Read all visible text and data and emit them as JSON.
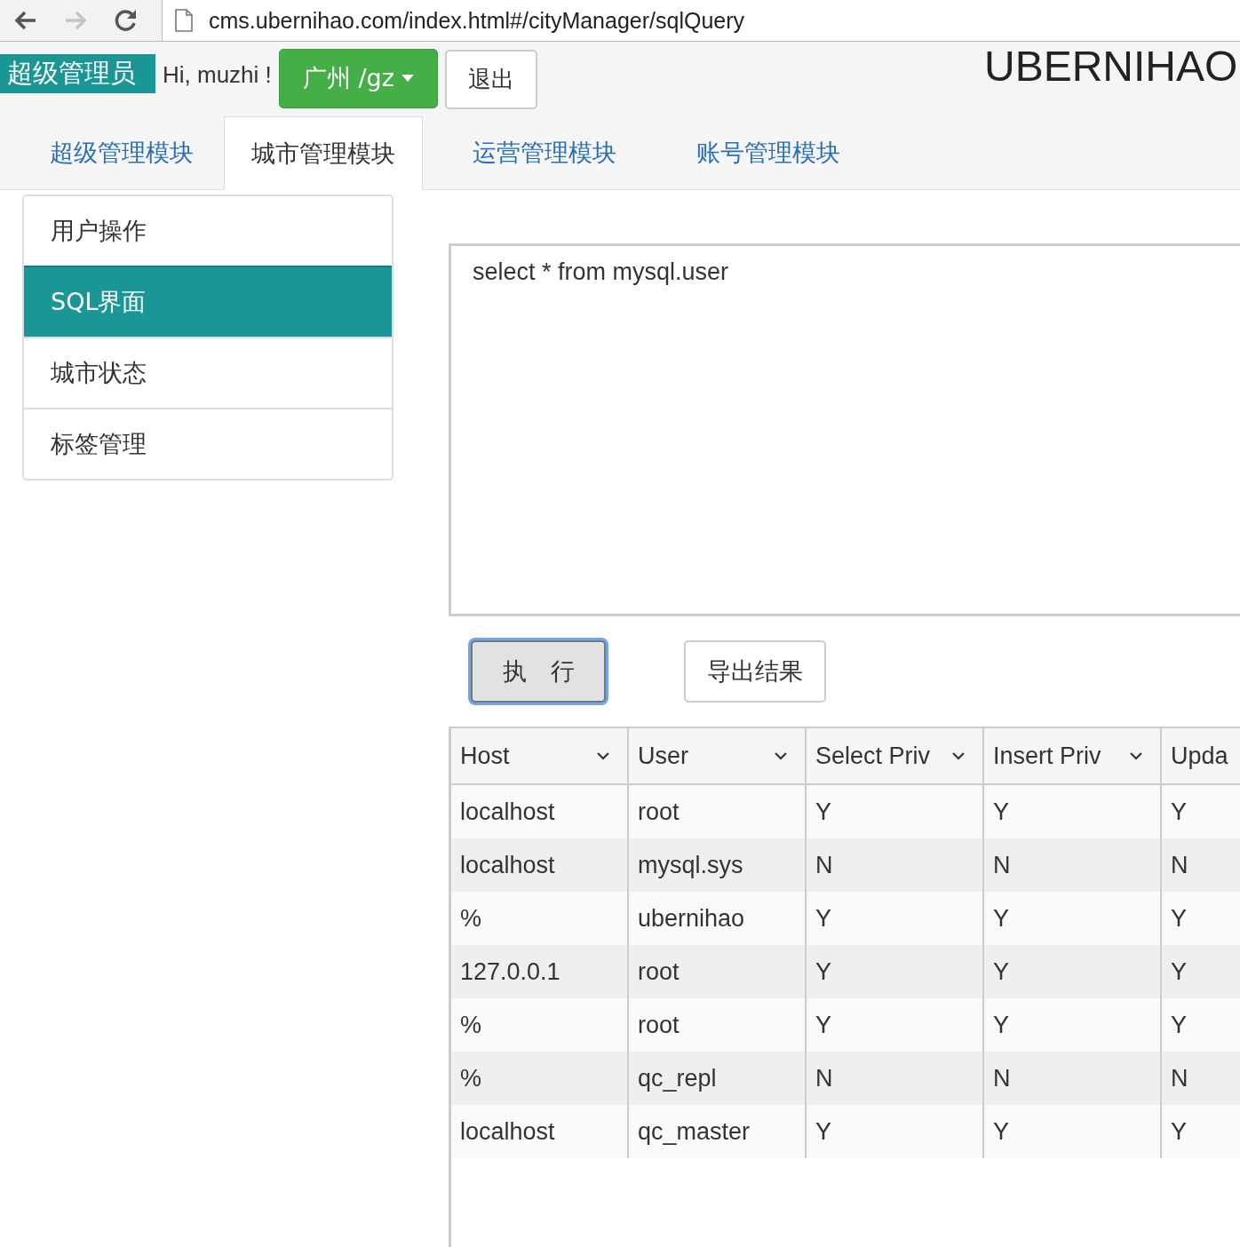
{
  "browser": {
    "url": "cms.ubernihao.com/index.html#/cityManager/sqlQuery",
    "back_disabled": false,
    "forward_disabled": true
  },
  "header": {
    "role_badge": "超级管理员",
    "greeting": "Hi, muzhi !",
    "city_button": "广州 /gz",
    "logout_button": "退出",
    "site_title": "UBERNIHAO"
  },
  "tabs": [
    {
      "label": "超级管理模块",
      "selected": false
    },
    {
      "label": "城市管理模块",
      "selected": true
    },
    {
      "label": "运营管理模块",
      "selected": false
    },
    {
      "label": "账号管理模块",
      "selected": false
    }
  ],
  "sidebar": {
    "items": [
      {
        "label": "用户操作",
        "selected": false
      },
      {
        "label": "SQL界面",
        "selected": true
      },
      {
        "label": "城市状态",
        "selected": false
      },
      {
        "label": "标签管理",
        "selected": false
      }
    ]
  },
  "query": {
    "value": "select * from mysql.user"
  },
  "buttons": [
    {
      "label": "执　行",
      "kind": "focused"
    },
    {
      "label": "导出结果",
      "kind": "default"
    }
  ],
  "table": {
    "columns": [
      "Host",
      "User",
      "Select Priv",
      "Insert Priv",
      "Upda"
    ],
    "rows": [
      [
        "localhost",
        "root",
        "Y",
        "Y",
        "Y"
      ],
      [
        "localhost",
        "mysql.sys",
        "N",
        "N",
        "N"
      ],
      [
        "%",
        "ubernihao",
        "Y",
        "Y",
        "Y"
      ],
      [
        "127.0.0.1",
        "root",
        "Y",
        "Y",
        "Y"
      ],
      [
        "%",
        "root",
        "Y",
        "Y",
        "Y"
      ],
      [
        "%",
        "qc_repl",
        "N",
        "N",
        "N"
      ],
      [
        "localhost",
        "qc_master",
        "Y",
        "Y",
        "Y"
      ]
    ]
  }
}
